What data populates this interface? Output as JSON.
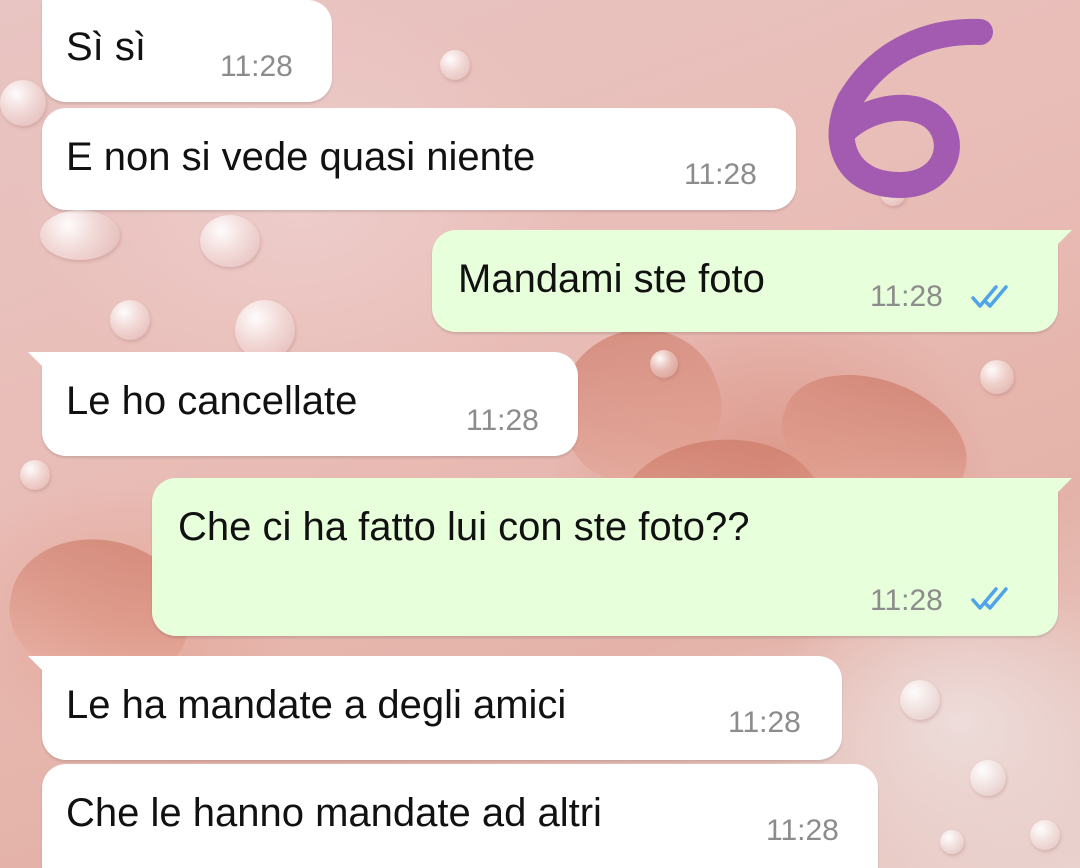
{
  "annotation": {
    "label": "6",
    "color": "#a25bb0"
  },
  "colors": {
    "incoming_bubble": "#ffffff",
    "outgoing_bubble": "#e7ffdb",
    "read_ticks": "#4fa3e8",
    "time_text": "#8c8c8c"
  },
  "messages": [
    {
      "direction": "incoming",
      "text": "Sì sì",
      "time": "11:28"
    },
    {
      "direction": "incoming",
      "text": "E non si vede quasi niente",
      "time": "11:28"
    },
    {
      "direction": "outgoing",
      "text": "Mandami ste foto",
      "time": "11:28",
      "status": "read-double-check-icon"
    },
    {
      "direction": "incoming",
      "text": "Le ho cancellate",
      "time": "11:28"
    },
    {
      "direction": "outgoing",
      "text": "Che ci ha fatto lui con ste foto??",
      "time": "11:28",
      "status": "read-double-check-icon"
    },
    {
      "direction": "incoming",
      "text": "Le ha mandate a degli amici",
      "time": "11:28"
    },
    {
      "direction": "incoming",
      "text": "Che le hanno mandate ad altri",
      "time": "11:28"
    }
  ]
}
